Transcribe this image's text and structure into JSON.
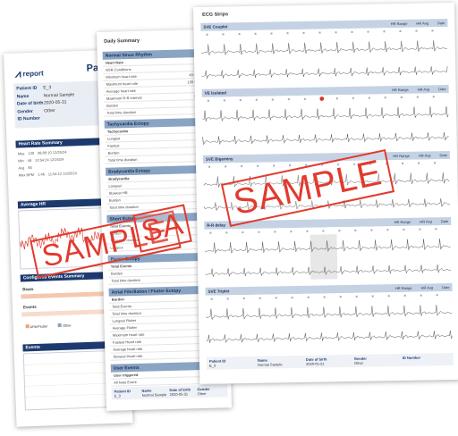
{
  "patient_report": {
    "logo": "report",
    "title": "Patie",
    "fields": [
      {
        "k": "Patient ID",
        "v": "E_3"
      },
      {
        "k": "Name",
        "v": "Normal Sample"
      },
      {
        "k": "Date of birth",
        "v": "2020-05-31"
      },
      {
        "k": "Gender",
        "v": "Other"
      },
      {
        "k": "ID Number",
        "v": ""
      }
    ],
    "sections": {
      "heart_rate": "Heart Rate Summary",
      "average_hr": "Average HR",
      "config": "Configured Events Summary",
      "events": "Events"
    },
    "hr_rows": [
      {
        "l": "Max",
        "a": "130",
        "b": "06:00:10 12/25/24"
      },
      {
        "l": "Min",
        "a": "49",
        "b": "13:54:24 12/25/24"
      },
      {
        "l": "Avg",
        "a": "65",
        "b": ""
      },
      {
        "l": "Max BPM",
        "a": "1:46",
        "b": "11:54:12 12/25/24"
      }
    ],
    "config_labels": {
      "beats": "Beats",
      "events": "Events"
    },
    "legend": {
      "a": "AFib/Flutter",
      "b": "Other"
    }
  },
  "summary": {
    "title": "Daily Summary",
    "sections": [
      {
        "head": "Normal Sinus Rhythm",
        "rows": [
          [
            "Heart Rate",
            ""
          ],
          [
            "NSR Conditions",
            "58,449 beats"
          ],
          [
            "Minimum heart rate",
            "49 bpm at 13:54"
          ],
          [
            "Maximum heart rate",
            "130 bpm at 06:00"
          ],
          [
            "Average heart rate",
            "72 bpm"
          ],
          [
            "Maximum R-R interval",
            "1.3 s at 03:47"
          ],
          [
            "Burden",
            "100.00 %"
          ],
          [
            "Total time duration",
            "23h 11m 9s"
          ]
        ]
      },
      {
        "head": "Tachycardia Ectopy",
        "rows": [
          [
            "Tachycardia",
            "0 events"
          ],
          [
            "Longest",
            ""
          ],
          [
            "Fastest",
            ""
          ],
          [
            "Burden",
            "0.00 %"
          ],
          [
            "Total time duration",
            "0s"
          ]
        ]
      },
      {
        "head": "Bradycardia Ectopy",
        "rows": [
          [
            "Bradycardia",
            "0 events"
          ],
          [
            "Longest",
            ""
          ],
          [
            "Slowest HR",
            ""
          ],
          [
            "Burden",
            "0.00 %"
          ],
          [
            "Total time duration",
            "0s"
          ]
        ]
      },
      {
        "head": "Short Ectopy",
        "rows": [
          [
            "Total Events",
            "0 events"
          ],
          [
            "Burden",
            "0.00 %"
          ],
          [
            "Total time duration",
            "0s"
          ],
          [
            "Longest",
            ""
          ]
        ]
      },
      {
        "head": "Pause Ectopy",
        "rows": [
          [
            "Total Events",
            "0 events"
          ],
          [
            "Burden",
            "0.00 %"
          ],
          [
            "Total time duration",
            "0s"
          ]
        ]
      },
      {
        "head": "Atrial Fibrillation / Flutter Ectopy",
        "rows": [
          [
            "Burden",
            "0.00 %"
          ],
          [
            "Total Events",
            "0 events"
          ],
          [
            "Total time duration",
            "0s"
          ],
          [
            "Longest Flutter",
            ""
          ],
          [
            "Average Flutter",
            ""
          ],
          [
            "Maximum heart rate",
            ""
          ],
          [
            "Fastest Heart rate",
            ""
          ],
          [
            "Average heart rate",
            "bpm"
          ],
          [
            "Slowest Heart rate",
            ""
          ]
        ]
      },
      {
        "head": "User Events",
        "rows": [
          [
            "User triggered",
            "0 events"
          ],
          [
            "All Note Event",
            "0 events"
          ]
        ]
      }
    ],
    "footer": [
      {
        "k": "Patient ID",
        "v": "E_3"
      },
      {
        "k": "Name",
        "v": "Normal Sample"
      },
      {
        "k": "Date of birth",
        "v": "2020-05-31"
      },
      {
        "k": "Gender",
        "v": "Other"
      },
      {
        "k": "ID Number",
        "v": ""
      }
    ]
  },
  "strips": {
    "title": "ECG Strips",
    "items": [
      {
        "name": "SVE Couplet",
        "hr_range": "HR Range",
        "hr_avg": "HR Avg",
        "date": "Date"
      },
      {
        "name": "VE Isolated",
        "hr_range": "HR Range",
        "hr_avg": "HR Avg",
        "date": "Date"
      },
      {
        "name": "SVE Bigeminy",
        "hr_range": "HR Range",
        "hr_avg": "HR Avg",
        "date": "Date"
      },
      {
        "name": "R-R delay",
        "hr_range": "HR Range",
        "hr_avg": "HR Avg",
        "date": "Date"
      },
      {
        "name": "SVE Triplet",
        "hr_range": "HR Range",
        "hr_avg": "HR Avg",
        "date": "Date"
      }
    ],
    "footer": [
      {
        "k": "Patient ID",
        "v": "E_3"
      },
      {
        "k": "Name",
        "v": "Normal Sample"
      },
      {
        "k": "Date of birth",
        "v": "2020-05-31"
      },
      {
        "k": "Gender",
        "v": "Other"
      },
      {
        "k": "ID Number",
        "v": ""
      }
    ]
  },
  "watermark": "SAMPLE",
  "colors": {
    "accent": "#1d3a6e",
    "stamp": "#e23a2e",
    "strip_head": "#c5d2e4"
  }
}
